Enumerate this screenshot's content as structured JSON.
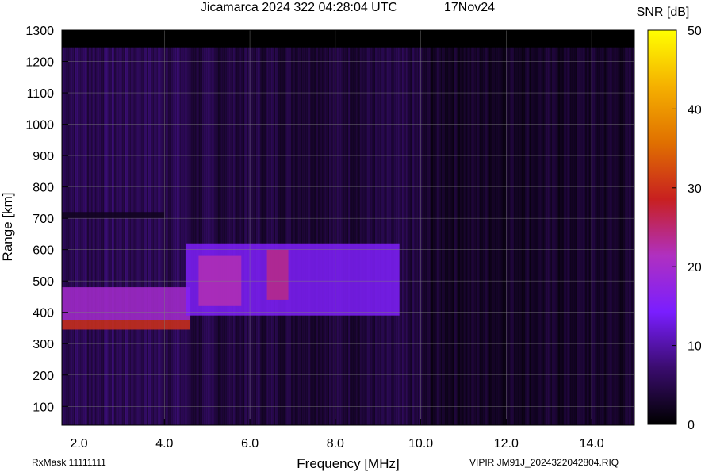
{
  "chart_data": {
    "type": "heatmap",
    "title": "Jicamarca 2024 322 04:28:04 UTC",
    "date_label": "17Nov24",
    "xlabel": "Frequency [MHz]",
    "ylabel": "Range [km]",
    "xlim": [
      1.6,
      15.0
    ],
    "ylim": [
      40,
      1300
    ],
    "x_ticks": [
      "2.0",
      "4.0",
      "6.0",
      "8.0",
      "10.0",
      "12.0",
      "14.0"
    ],
    "x_tick_values": [
      2,
      4,
      6,
      8,
      10,
      12,
      14
    ],
    "y_ticks": [
      "100",
      "200",
      "300",
      "400",
      "500",
      "600",
      "700",
      "800",
      "900",
      "1000",
      "1100",
      "1200",
      "1300"
    ],
    "y_tick_values": [
      100,
      200,
      300,
      400,
      500,
      600,
      700,
      800,
      900,
      1000,
      1100,
      1200,
      1300
    ],
    "grid": true,
    "colorbar": {
      "label": "SNR [dB]",
      "range": [
        0,
        50
      ],
      "ticks": [
        "0",
        "10",
        "20",
        "30",
        "40",
        "50"
      ],
      "tick_values": [
        0,
        10,
        20,
        30,
        40,
        50
      ],
      "colors": [
        "#000000",
        "#3a0c6e",
        "#7a1eff",
        "#b030c0",
        "#c82020",
        "#e07000",
        "#f5b000",
        "#ffff00"
      ]
    },
    "data_range_max_km": 1245,
    "echo_regions": [
      {
        "fmin": 1.6,
        "fmax": 4.6,
        "rmin": 345,
        "rmax": 375,
        "snr": 30
      },
      {
        "fmin": 1.6,
        "fmax": 4.6,
        "rmin": 375,
        "rmax": 480,
        "snr": 20
      },
      {
        "fmin": 4.5,
        "fmax": 9.5,
        "rmin": 390,
        "rmax": 620,
        "snr": 15
      },
      {
        "fmin": 4.8,
        "fmax": 5.8,
        "rmin": 420,
        "rmax": 580,
        "snr": 22
      },
      {
        "fmin": 6.4,
        "fmax": 6.9,
        "rmin": 440,
        "rmax": 600,
        "snr": 24
      },
      {
        "fmin": 1.6,
        "fmax": 4.0,
        "rmin": 700,
        "rmax": 720,
        "snr": 2
      }
    ],
    "footer_left": "RxMask 11111111",
    "footer_right": "VIPIR  JM91J_2024322042804.RIQ"
  }
}
